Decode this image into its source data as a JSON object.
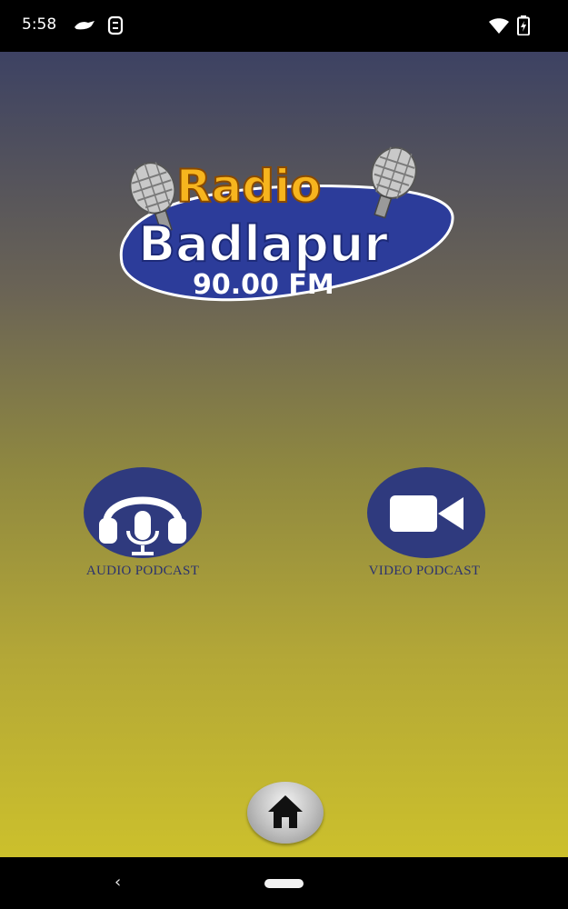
{
  "status_bar": {
    "time": "5:58",
    "icons": [
      "notification-icon",
      "sync-icon",
      "wifi-icon",
      "battery-charging-icon"
    ]
  },
  "logo": {
    "line1": "Radio",
    "line2": "Badlapur",
    "line3": "90.00 FM",
    "colors": {
      "radio_text": "#f7b51e",
      "badlapur_text": "#ffffff",
      "swoosh": "#2c3c9a",
      "fm_text": "#ffffff"
    }
  },
  "podcasts": {
    "audio": {
      "label": "AUDIO PODCAST",
      "icon": "headphones-mic-icon"
    },
    "video": {
      "label": "VIDEO PODCAST",
      "icon": "video-camera-icon"
    }
  },
  "bottom": {
    "home_icon": "home-icon"
  },
  "nav_bar": {
    "back_glyph": "‹"
  },
  "colors": {
    "button_bg": "#2f3a7e",
    "label_text": "#2b326e"
  }
}
